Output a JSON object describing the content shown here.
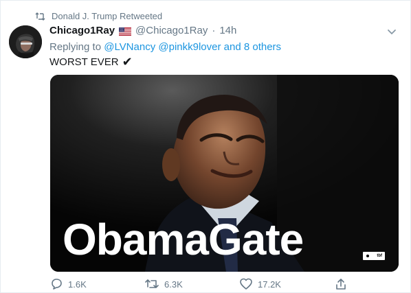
{
  "retweet_context": {
    "text": "Donald J. Trump Retweeted"
  },
  "tweet": {
    "display_name": "Chicago1Ray",
    "handle": "@Chicago1Ray",
    "separator": "·",
    "timestamp": "14h",
    "replying_prefix": "Replying to",
    "replying_mentions": [
      "@LVNancy",
      "@pinkk9lover"
    ],
    "replying_suffix": "and 8 others",
    "body": "WORST EVER",
    "body_emoji": "✔"
  },
  "media": {
    "overlay_text": "ObamaGate",
    "watermark": "tbf"
  },
  "actions": {
    "replies": "1.6K",
    "retweets": "6.3K",
    "likes": "17.2K"
  },
  "colors": {
    "link": "#1b95e0",
    "muted": "#657786",
    "text": "#14171a",
    "border": "#e6ecf0"
  },
  "icons": [
    "retweet-icon",
    "us-flag-icon",
    "chevron-down-icon",
    "reply-icon",
    "like-icon",
    "share-icon"
  ]
}
